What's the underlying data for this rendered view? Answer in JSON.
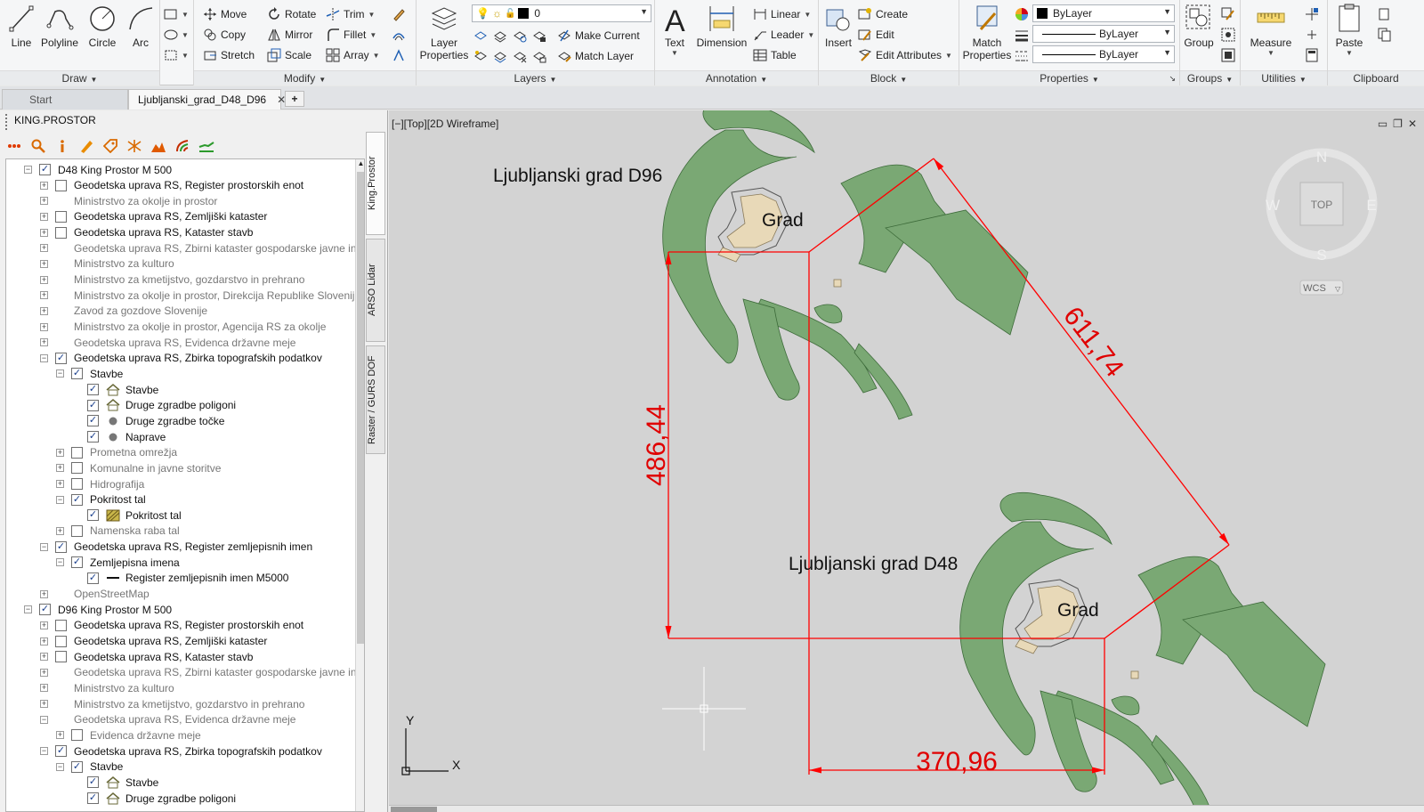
{
  "ribbon": {
    "draw": {
      "title": "Draw",
      "line": "Line",
      "polyline": "Polyline",
      "circle": "Circle",
      "arc": "Arc"
    },
    "modify": {
      "title": "Modify",
      "move": "Move",
      "rotate": "Rotate",
      "trim": "Trim",
      "copy": "Copy",
      "mirror": "Mirror",
      "fillet": "Fillet",
      "stretch": "Stretch",
      "scale": "Scale",
      "array": "Array"
    },
    "layers": {
      "title": "Layers",
      "layer_properties": "Layer Properties",
      "current_layer": "0",
      "make_current": "Make Current",
      "match_layer": "Match Layer"
    },
    "annotation": {
      "title": "Annotation",
      "text": "Text",
      "dimension": "Dimension",
      "linear": "Linear",
      "leader": "Leader",
      "table": "Table"
    },
    "block": {
      "title": "Block",
      "insert": "Insert",
      "create": "Create",
      "edit": "Edit",
      "edit_attributes": "Edit Attributes"
    },
    "properties": {
      "title": "Properties",
      "match_properties": "Match Properties",
      "color": "ByLayer",
      "lineweight": "ByLayer",
      "linetype": "ByLayer"
    },
    "groups": {
      "title": "Groups",
      "group": "Group"
    },
    "utilities": {
      "title": "Utilities",
      "measure": "Measure"
    },
    "clipboard": {
      "title": "Clipboard",
      "paste": "Paste"
    }
  },
  "tabs": {
    "start": "Start",
    "drawing": "Ljubljanski_grad_D48_D96",
    "add": "+"
  },
  "palette": {
    "title": "KING.PROSTOR",
    "side_tabs": [
      "King.Prostor",
      "ARSO Lidar",
      "Raster / GURS DOF"
    ],
    "tree": [
      {
        "level": 0,
        "exp": "-",
        "chk": true,
        "style": "plain",
        "label": "D48 King Prostor M 500"
      },
      {
        "level": 1,
        "exp": "+",
        "chk": false,
        "style": "plain",
        "label": "Geodetska uprava RS, Register prostorskih enot"
      },
      {
        "level": 1,
        "exp": "+",
        "chk": null,
        "style": "gray",
        "label": "Ministrstvo za okolje in prostor"
      },
      {
        "level": 1,
        "exp": "+",
        "chk": false,
        "style": "plain",
        "label": "Geodetska uprava RS, Zemljiški kataster"
      },
      {
        "level": 1,
        "exp": "+",
        "chk": false,
        "style": "plain",
        "label": "Geodetska uprava RS, Kataster stavb"
      },
      {
        "level": 1,
        "exp": "+",
        "chk": null,
        "style": "gray",
        "label": "Geodetska uprava RS, Zbirni kataster gospodarske javne infra"
      },
      {
        "level": 1,
        "exp": "+",
        "chk": null,
        "style": "gray",
        "label": "Ministrstvo za kulturo"
      },
      {
        "level": 1,
        "exp": "+",
        "chk": null,
        "style": "gray",
        "label": "Ministrstvo za kmetijstvo, gozdarstvo in prehrano"
      },
      {
        "level": 1,
        "exp": "+",
        "chk": null,
        "style": "gray",
        "label": "Ministrstvo za okolje in prostor, Direkcija Republike Slovenije"
      },
      {
        "level": 1,
        "exp": "+",
        "chk": null,
        "style": "gray",
        "label": "Zavod za gozdove Slovenije"
      },
      {
        "level": 1,
        "exp": "+",
        "chk": null,
        "style": "gray",
        "label": "Ministrstvo za okolje in prostor, Agencija RS za okolje"
      },
      {
        "level": 1,
        "exp": "+",
        "chk": null,
        "style": "gray",
        "label": "Geodetska uprava RS, Evidenca državne meje"
      },
      {
        "level": 1,
        "exp": "-",
        "chk": true,
        "style": "plain",
        "label": "Geodetska uprava RS, Zbirka topografskih podatkov"
      },
      {
        "level": 2,
        "exp": "-",
        "chk": true,
        "style": "plain",
        "label": "Stavbe"
      },
      {
        "level": 3,
        "exp": null,
        "chk": true,
        "icon": "house-icon",
        "style": "plain",
        "label": "Stavbe"
      },
      {
        "level": 3,
        "exp": null,
        "chk": true,
        "icon": "house-icon",
        "style": "plain",
        "label": "Druge zgradbe poligoni"
      },
      {
        "level": 3,
        "exp": null,
        "chk": true,
        "icon": "dot-icon",
        "style": "plain",
        "label": "Druge zgradbe točke"
      },
      {
        "level": 3,
        "exp": null,
        "chk": true,
        "icon": "dot-icon",
        "style": "plain",
        "label": "Naprave"
      },
      {
        "level": 2,
        "exp": "+",
        "chk": false,
        "style": "gray",
        "label": "Prometna omrežja"
      },
      {
        "level": 2,
        "exp": "+",
        "chk": false,
        "style": "gray",
        "label": "Komunalne in javne storitve"
      },
      {
        "level": 2,
        "exp": "+",
        "chk": false,
        "style": "gray",
        "label": "Hidrografija"
      },
      {
        "level": 2,
        "exp": "-",
        "chk": true,
        "style": "plain",
        "label": "Pokritost tal"
      },
      {
        "level": 3,
        "exp": null,
        "chk": true,
        "icon": "hatch-icon",
        "style": "plain",
        "label": "Pokritost tal"
      },
      {
        "level": 2,
        "exp": "+",
        "chk": false,
        "style": "gray",
        "label": "Namenska raba tal"
      },
      {
        "level": 1,
        "exp": "-",
        "chk": true,
        "style": "plain",
        "label": "Geodetska uprava RS, Register zemljepisnih imen"
      },
      {
        "level": 2,
        "exp": "-",
        "chk": true,
        "style": "plain",
        "label": "Zemljepisna imena"
      },
      {
        "level": 3,
        "exp": null,
        "chk": true,
        "icon": "line-icon",
        "style": "plain",
        "label": "Register zemljepisnih imen M5000"
      },
      {
        "level": 1,
        "exp": "+",
        "chk": null,
        "style": "gray",
        "label": "OpenStreetMap"
      },
      {
        "level": 0,
        "exp": "-",
        "chk": true,
        "style": "plain",
        "label": "D96 King Prostor M 500"
      },
      {
        "level": 1,
        "exp": "+",
        "chk": false,
        "style": "plain",
        "label": "Geodetska uprava RS, Register prostorskih enot"
      },
      {
        "level": 1,
        "exp": "+",
        "chk": false,
        "style": "plain",
        "label": "Geodetska uprava RS, Zemljiški kataster"
      },
      {
        "level": 1,
        "exp": "+",
        "chk": false,
        "style": "plain",
        "label": "Geodetska uprava RS, Kataster stavb"
      },
      {
        "level": 1,
        "exp": "+",
        "chk": null,
        "style": "gray",
        "label": "Geodetska uprava RS, Zbirni kataster gospodarske javne infra"
      },
      {
        "level": 1,
        "exp": "+",
        "chk": null,
        "style": "gray",
        "label": "Ministrstvo za kulturo"
      },
      {
        "level": 1,
        "exp": "+",
        "chk": null,
        "style": "gray",
        "label": "Ministrstvo za kmetijstvo, gozdarstvo in prehrano"
      },
      {
        "level": 1,
        "exp": "-",
        "chk": null,
        "style": "gray",
        "label": "Geodetska uprava RS, Evidenca državne meje"
      },
      {
        "level": 2,
        "exp": "+",
        "chk": false,
        "style": "gray",
        "label": "Evidenca državne meje"
      },
      {
        "level": 1,
        "exp": "-",
        "chk": true,
        "style": "plain",
        "label": "Geodetska uprava RS, Zbirka topografskih podatkov"
      },
      {
        "level": 2,
        "exp": "-",
        "chk": true,
        "style": "plain",
        "label": "Stavbe"
      },
      {
        "level": 3,
        "exp": null,
        "chk": true,
        "icon": "house-icon",
        "style": "plain",
        "label": "Stavbe"
      },
      {
        "level": 3,
        "exp": null,
        "chk": true,
        "icon": "house-icon",
        "style": "plain",
        "label": "Druge zgradbe poligoni"
      }
    ]
  },
  "viewport": {
    "label": "[−][Top][2D Wireframe]",
    "label_d96": "Ljubljanski grad D96",
    "label_d48": "Ljubljanski grad D48",
    "grad_label": "Grad",
    "dim_vertical": "486,44",
    "dim_diagonal": "611,74",
    "dim_horizontal": "370,96",
    "viewcube": {
      "top": "TOP",
      "n": "N",
      "s": "S",
      "e": "E",
      "w": "W",
      "wcs": "WCS"
    },
    "ucs": {
      "x": "X",
      "y": "Y"
    }
  },
  "colors": {
    "vegetation_fill": "#7aa874",
    "vegetation_stroke": "#3d6b3a",
    "building_fill": "#e8d9b8",
    "dimension": "#ff0000",
    "canvas_bg": "#d3d3d3"
  }
}
